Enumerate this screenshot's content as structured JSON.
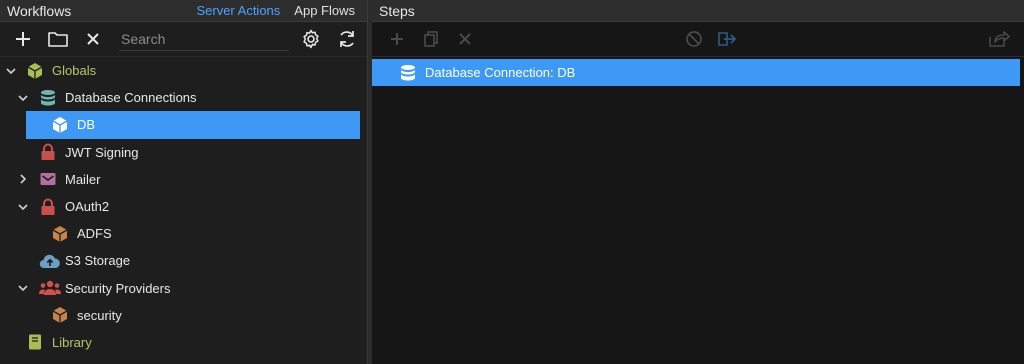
{
  "left_panel": {
    "title": "Workflows",
    "tabs": [
      {
        "label": "Server Actions",
        "active": true
      },
      {
        "label": "App Flows",
        "active": false
      }
    ]
  },
  "toolbar": {
    "search_placeholder": "Search",
    "icons": [
      "plus-icon",
      "folder-icon",
      "close-icon",
      "gear-icon",
      "refresh-icon"
    ]
  },
  "tree": {
    "items": [
      {
        "label": "Globals",
        "icon": "cube-icon",
        "expanded": true
      },
      {
        "label": "Database Connections",
        "icon": "database-icon",
        "expanded": true
      },
      {
        "label": "DB",
        "icon": "cube-icon",
        "selected": true
      },
      {
        "label": "JWT Signing",
        "icon": "lock-icon"
      },
      {
        "label": "Mailer",
        "icon": "envelope-icon",
        "expanded": false
      },
      {
        "label": "OAuth2",
        "icon": "lock-icon",
        "expanded": true
      },
      {
        "label": "ADFS",
        "icon": "cube-icon"
      },
      {
        "label": "S3 Storage",
        "icon": "cloud-upload-icon"
      },
      {
        "label": "Security Providers",
        "icon": "users-icon",
        "expanded": true
      },
      {
        "label": "security",
        "icon": "cube-icon"
      },
      {
        "label": "Library",
        "icon": "book-icon"
      }
    ]
  },
  "steps_panel": {
    "title": "Steps",
    "selected_step": "Database Connection: DB"
  },
  "colors": {
    "accent": "#3d99f5",
    "tab_active": "#4aa3ff",
    "globals_green": "#b5c76a",
    "cube_orange": "#c8834a",
    "lock_red": "#d05a52"
  }
}
